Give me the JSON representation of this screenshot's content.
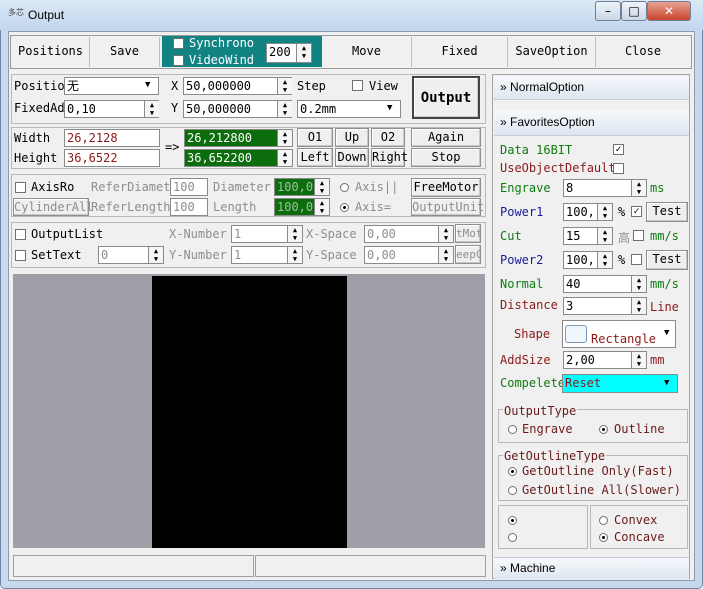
{
  "window": {
    "title": "Output",
    "app_icon": "多芯"
  },
  "toolbar": {
    "positions": "Positions",
    "save": "Save",
    "synchronous": "Synchrono",
    "videowind": "VideoWind",
    "video_value": "200",
    "move": "Move",
    "fixed": "Fixed",
    "saveoption": "SaveOption",
    "close": "Close"
  },
  "position_panel": {
    "position_label": "Positio",
    "position_value": "无",
    "fixedad_label": "FixedAd",
    "fixedad_value": "0,10",
    "x_label": "X",
    "x_value": "50,000000",
    "y_label": "Y",
    "y_value": "50,000000",
    "step_label": "Step",
    "view_label": "View",
    "step_value": "0.2mm",
    "output_button": "Output"
  },
  "size_panel": {
    "width_label": "Width",
    "width_value": "26,2128",
    "height_label": "Height",
    "height_value": "36,6522",
    "arrow": "=>",
    "width_result": "26,212800",
    "height_result": "36,652200",
    "o1": "O1",
    "up": "Up",
    "o2": "O2",
    "left": "Left",
    "down": "Down",
    "right": "Right",
    "again": "Again",
    "stop": "Stop"
  },
  "axis_panel": {
    "axisro": "AxisRo",
    "referdiamet": "ReferDiamet",
    "referdiamet_value": "100",
    "diameter": "Diameter",
    "diameter_value": "100,0",
    "axis_parallel": "Axis||",
    "freemotor": "FreeMotor",
    "cylinderall": "CylinderAll",
    "referlength": "ReferLength",
    "referlength_value": "100",
    "length": "Length",
    "length_value": "100,0",
    "axis_eq": "Axis=",
    "outputunit": "OutputUnit"
  },
  "output_panel": {
    "outputlist": "OutputList",
    "xnumber": "X-Number",
    "xnumber_value": "1",
    "xspace": "X-Space",
    "xspace_value": "0,00",
    "tmot": "tMot",
    "settext": "SetText",
    "settext_value": "0",
    "ynumber": "Y-Number",
    "ynumber_value": "1",
    "yspace": "Y-Space",
    "yspace_value": "0,00",
    "eepc": "eepC"
  },
  "right_panel": {
    "normal_option": "NormalOption",
    "favorites_option": "FavoritesOption",
    "data16bit": "Data 16BIT",
    "useobjectdefault": "UseObjectDefault",
    "engrave_label": "Engrave",
    "engrave_value": "8",
    "engrave_unit": "ms",
    "power1_label": "Power1",
    "power1_value": "100,",
    "percent": "%",
    "test": "Test",
    "cut_label": "Cut",
    "cut_value": "15",
    "cut_hi": "高",
    "cut_unit": "mm/s",
    "power2_label": "Power2",
    "power2_value": "100,",
    "normal_label": "Normal",
    "normal_value": "40",
    "normal_unit": "mm/s",
    "distance_label": "Distance",
    "distance_value": "3",
    "distance_unit": "Line",
    "shape_label": "Shape",
    "shape_value": "Rectangle",
    "addsize_label": "AddSize",
    "addsize_value": "2,00",
    "addsize_unit": "mm",
    "compelete_label": "Compelete",
    "compelete_value": "Reset",
    "outputtype_title": "OutputType",
    "engrave_radio": "Engrave",
    "outline_radio": "Outline",
    "getoutline_title": "GetOutlineType",
    "getoutline_fast": "GetOutline Only(Fast)",
    "getoutline_all": "GetOutline All(Slower)",
    "convex": "Convex",
    "concave": "Concave",
    "machine": "Machine"
  },
  "colors": {
    "teal": "#118383",
    "green_field": "#0b6d0b",
    "cyan": "#00ffff",
    "canvas": "#000000",
    "canvas_bg": "#a09fa8"
  }
}
